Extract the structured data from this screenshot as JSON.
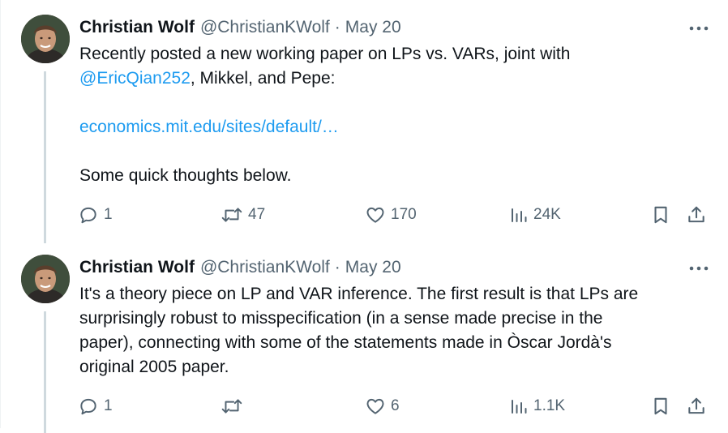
{
  "tweets": [
    {
      "author_name": "Christian Wolf",
      "handle": "@ChristianKWolf",
      "separator": "·",
      "date": "May 20",
      "more_icon": "more-horizontal-icon",
      "text": {
        "line1": "Recently posted a new working paper on LPs vs. VARs, joint with",
        "mention": "@EricQian252",
        "line2_rest": ", Mikkel, and Pepe:",
        "link": "economics.mit.edu/sites/default/…",
        "line4": "Some quick thoughts below."
      },
      "actions": {
        "replies": "1",
        "reposts": "47",
        "likes": "170",
        "views": "24K"
      }
    },
    {
      "author_name": "Christian Wolf",
      "handle": "@ChristianKWolf",
      "separator": "·",
      "date": "May 20",
      "more_icon": "more-horizontal-icon",
      "text": {
        "line1": "It's a theory piece on LP and VAR inference. The first result is that LPs are",
        "line2": "surprisingly robust to misspecification (in a sense made precise in the",
        "line3": "paper), connecting with some of the statements made in Òscar Jordà's",
        "line4": "original 2005 paper."
      },
      "actions": {
        "replies": "1",
        "reposts": "",
        "likes": "6",
        "views": "1.1K"
      }
    }
  ],
  "colors": {
    "link": "#1d9bf0",
    "text": "#0f1419",
    "secondary": "#536471",
    "thread_line": "#cfd9de"
  }
}
